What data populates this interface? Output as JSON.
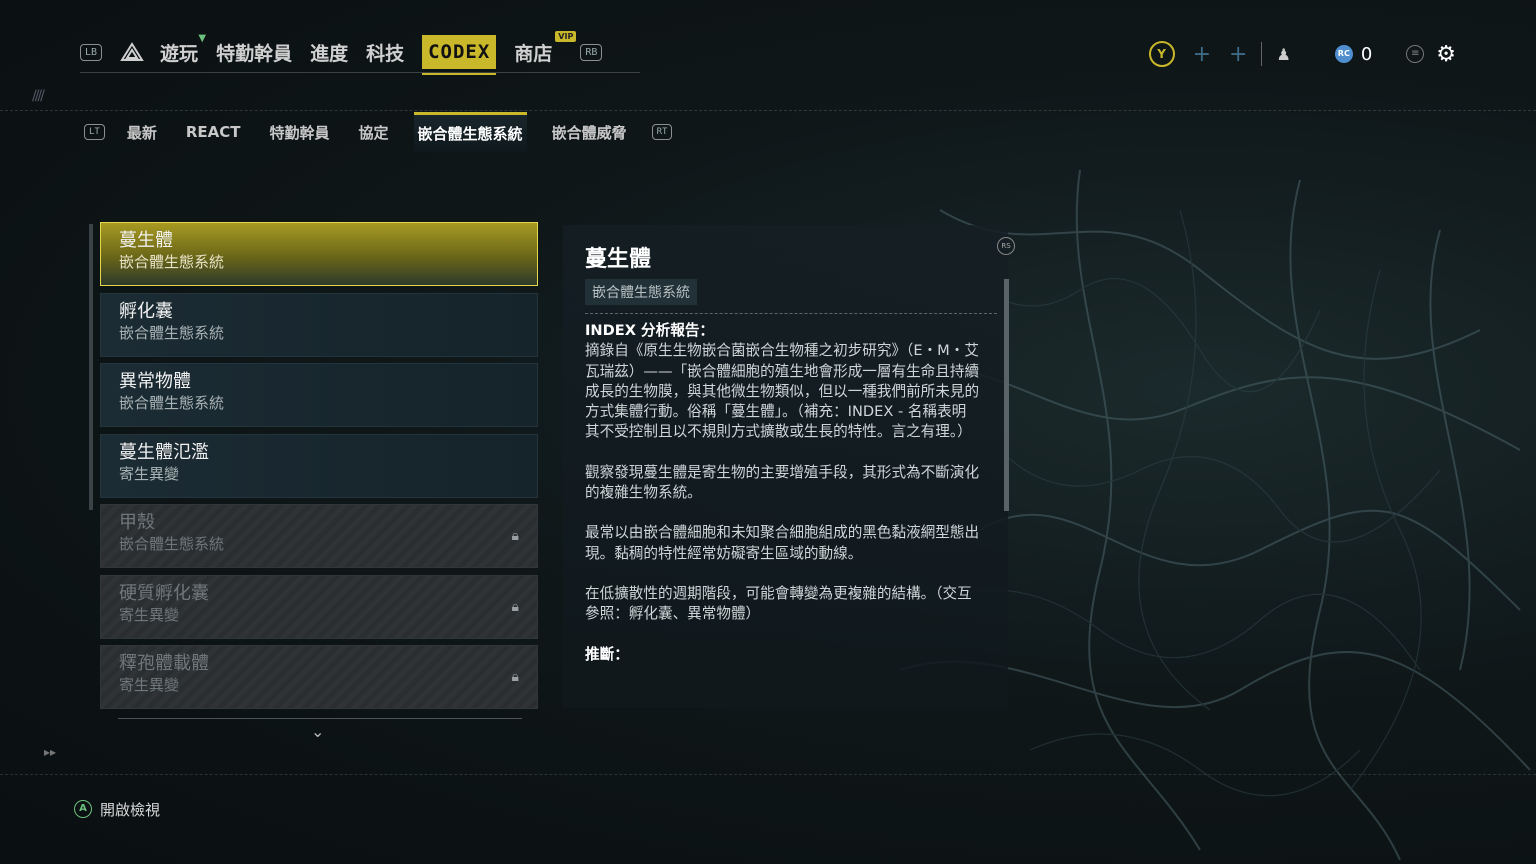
{
  "top_nav": {
    "lb": "LB",
    "rb": "RB",
    "items": [
      "遊玩",
      "特勤幹員",
      "進度",
      "科技",
      "CODEX",
      "商店"
    ],
    "active": "CODEX",
    "vip_badge": "VIP"
  },
  "top_right": {
    "y_button": "Y",
    "currency_icon": "RC",
    "currency_count": "0"
  },
  "sub_nav": {
    "lt": "LT",
    "rt": "RT",
    "items": [
      "最新",
      "REACT",
      "特勤幹員",
      "協定",
      "嵌合體生態系統",
      "嵌合體威脅"
    ],
    "active": "嵌合體生態系統"
  },
  "entries": [
    {
      "title": "蔓生體",
      "subtitle": "嵌合體生態系統",
      "state": "selected"
    },
    {
      "title": "孵化囊",
      "subtitle": "嵌合體生態系統",
      "state": "unlocked"
    },
    {
      "title": "異常物體",
      "subtitle": "嵌合體生態系統",
      "state": "unlocked"
    },
    {
      "title": "蔓生體氾濫",
      "subtitle": "寄生異變",
      "state": "unlocked"
    },
    {
      "title": "甲殼",
      "subtitle": "嵌合體生態系統",
      "state": "locked"
    },
    {
      "title": "硬質孵化囊",
      "subtitle": "寄生異變",
      "state": "locked"
    },
    {
      "title": "釋孢體載體",
      "subtitle": "寄生異變",
      "state": "locked"
    }
  ],
  "detail": {
    "rs": "RS",
    "title": "蔓生體",
    "tag": "嵌合體生態系統",
    "heading": "INDEX 分析報告：",
    "p1": "摘錄自《原生生物嵌合菌嵌合生物種之初步研究》（E・M・艾瓦瑞茲）——「嵌合體細胞的殖生地會形成一層有生命且持續成長的生物膜，與其他微生物類似，但以一種我們前所未見的方式集體行動。俗稱「蔓生體」。（補充：INDEX - 名稱表明其不受控制且以不規則方式擴散或生長的特性。言之有理。）",
    "p2": "觀察發現蔓生體是寄生物的主要增殖手段，其形式為不斷演化的複雜生物系統。",
    "p3": "最常以由嵌合體細胞和未知聚合細胞組成的黑色黏液網型態出現。黏稠的特性經常妨礙寄生區域的動線。",
    "p4": "在低擴散性的週期階段，可能會轉變為更複雜的結構。（交互參照：孵化囊、異常物體）",
    "p5": "推斷："
  },
  "footer": {
    "a_button": "A",
    "action_label": "開啟檢視"
  },
  "colors": {
    "accent": "#c8b82a",
    "locked": "#70777a",
    "positive": "#6cc17f",
    "currency": "#4f8fd0"
  }
}
